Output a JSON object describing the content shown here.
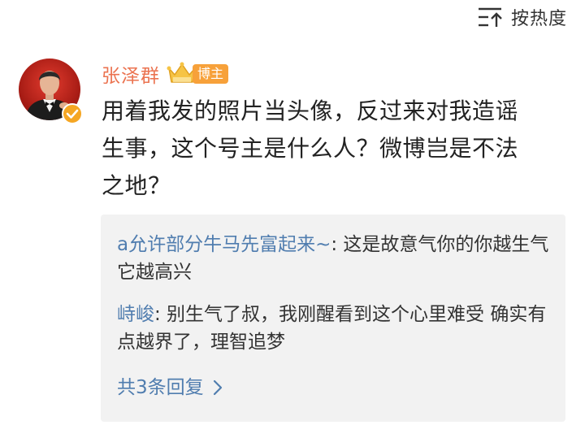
{
  "sort": {
    "label": "按热度",
    "icon": "sort-icon"
  },
  "post": {
    "username": "张泽群",
    "crown_icon": "crown-icon",
    "role_badge": "博主",
    "verified_icon": "verified-badge-icon",
    "comment_lines": [
      "用着我发的照片当头像，反过来对我造谣",
      "生事，这个号主是什么人？微博岂是不法",
      "之地？"
    ]
  },
  "replies": {
    "items": [
      {
        "author": "a允许部分牛马先富起来~",
        "separator": ":",
        "text": " 这是故意气你的你越生气它越高兴"
      },
      {
        "author": "峙峻",
        "separator": ":",
        "text": " 别生气了叔，我刚醒看到这个心里难受 确实有点越界了，理智追梦"
      }
    ],
    "more_label": "共3条回复",
    "more_icon": "chevron-right-icon"
  },
  "colors": {
    "username": "#eb7350",
    "link_blue": "#507daf",
    "badge_orange": "#f7a13a",
    "reply_bg": "#f2f2f2",
    "text": "#222222"
  }
}
